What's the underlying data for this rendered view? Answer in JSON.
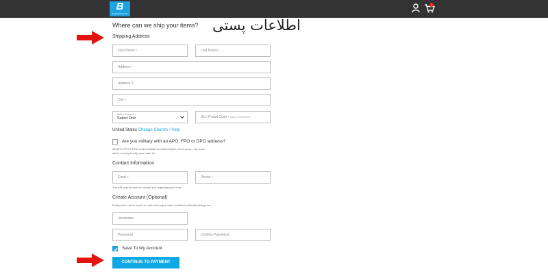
{
  "header": {
    "logo_mark": "B",
    "logo_subtext": "Bodybuilding.com",
    "cart_count": "1"
  },
  "overlay_text": "اطلاعات پستی",
  "page": {
    "heading": "Where can we ship your items?",
    "shipping_section": "Shipping Address",
    "fields": {
      "first_name": "First Name •",
      "last_name": "Last Name •",
      "address": "Address •",
      "address2": "Address 2",
      "city": "City •",
      "state_label": "State / Province •",
      "state_value": "Select One",
      "zip": "Zip / Postal Code •"
    },
    "zip_hint": "(xxxxx, xxxxx-xxxx)",
    "country": "United States",
    "country_links": "Change Country / Help",
    "military_label": "Are you military with an APO, FPO or DPO address?",
    "military_note_line1": "All APO, FPO & DPO orders default to United States. Don't worry... we know",
    "military_note_line2": "which country to ship your order to!",
    "contact_section": "Contact Information",
    "email": "Email •",
    "phone": "Phone •",
    "contact_note": "This will only be used to contact you regarding your order",
    "account_section": "Create Account (Optional)",
    "account_note": "Easily track orders, quick re-order and enjoy faster checkout at Bodybuilding.com",
    "username": "Username",
    "password": "Password",
    "confirm_password": "Confirm Password",
    "save_label": "Save To My Account",
    "continue_button": "CONTINUE TO PAYMENT"
  },
  "colors": {
    "topbar": "#333333",
    "accent": "#1aa3e0",
    "arrow": "#e3140f"
  }
}
